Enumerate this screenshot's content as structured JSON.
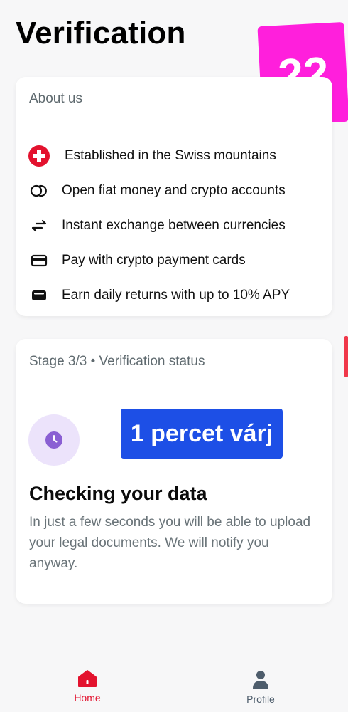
{
  "header": {
    "title": "Verification"
  },
  "sticker": {
    "text": "22"
  },
  "about": {
    "heading": "About us",
    "items": [
      {
        "icon": "swiss-flag-icon",
        "label": "Established in the Swiss mountains"
      },
      {
        "icon": "double-ring-icon",
        "label": "Open fiat money and crypto accounts"
      },
      {
        "icon": "exchange-arrows-icon",
        "label": "Instant exchange between currencies"
      },
      {
        "icon": "credit-card-icon",
        "label": "Pay with crypto payment cards"
      },
      {
        "icon": "wallet-icon",
        "label": "Earn daily returns with up to 10% APY"
      }
    ]
  },
  "verification": {
    "heading": "Stage 3/3 • Verification status",
    "overlay_label": "1 percet várj",
    "status_title": "Checking your data",
    "status_description": "In just a few seconds you will be able to upload your legal documents. We will notify you anyway."
  },
  "tabbar": {
    "home_label": "Home",
    "profile_label": "Profile"
  },
  "colors": {
    "accent_red": "#e3122e",
    "sticker_pink": "#ff1fdc",
    "overlay_blue": "#1d4fe6",
    "clock_purple": "#8a5fd3"
  }
}
